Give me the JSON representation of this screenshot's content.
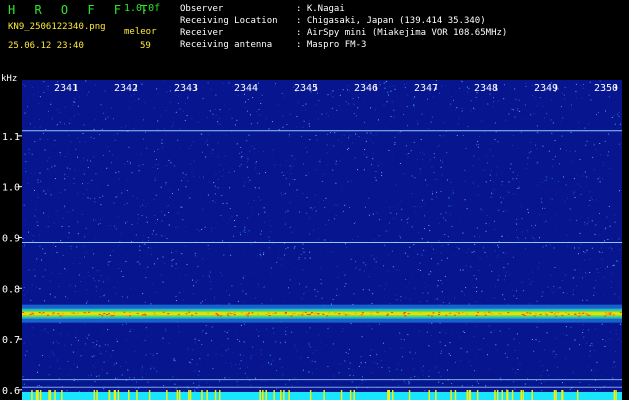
{
  "header": {
    "app_name": "H R O F F T",
    "version": "1.0.0f",
    "file_name": "KN9_2506122340.png",
    "datetime": "25.06.12 23:40",
    "meteor_label": "meleor",
    "meteor_count": "59"
  },
  "meta": [
    {
      "key": "Observer",
      "value": ": K.Nagai"
    },
    {
      "key": "Receiving Location",
      "value": ": Chigasaki, Japan (139.414 35.340)"
    },
    {
      "key": "Receiver",
      "value": ": AirSpy mini (Miakejima VOR 108.65MHz)"
    },
    {
      "key": "Receiving antenna",
      "value": ": Maspro FM-3"
    }
  ],
  "chart_data": {
    "type": "heatmap",
    "ylabel": "kHz",
    "x_ticks": [
      "2341",
      "2342",
      "2343",
      "2344",
      "2345",
      "2346",
      "2347",
      "2348",
      "2349",
      "2350"
    ],
    "y_ticks": [
      "1.1",
      "1.0",
      "0.9",
      "0.8",
      "0.7",
      "0.6"
    ],
    "ylim": [
      0.58,
      1.21
    ],
    "signal_band_khz": 0.75,
    "carrier_lines_khz": [
      1.11,
      0.89,
      0.62,
      0.605
    ],
    "colors": {
      "background": "#07158f",
      "band": "#e2e400",
      "line": "#9fdcff"
    }
  }
}
